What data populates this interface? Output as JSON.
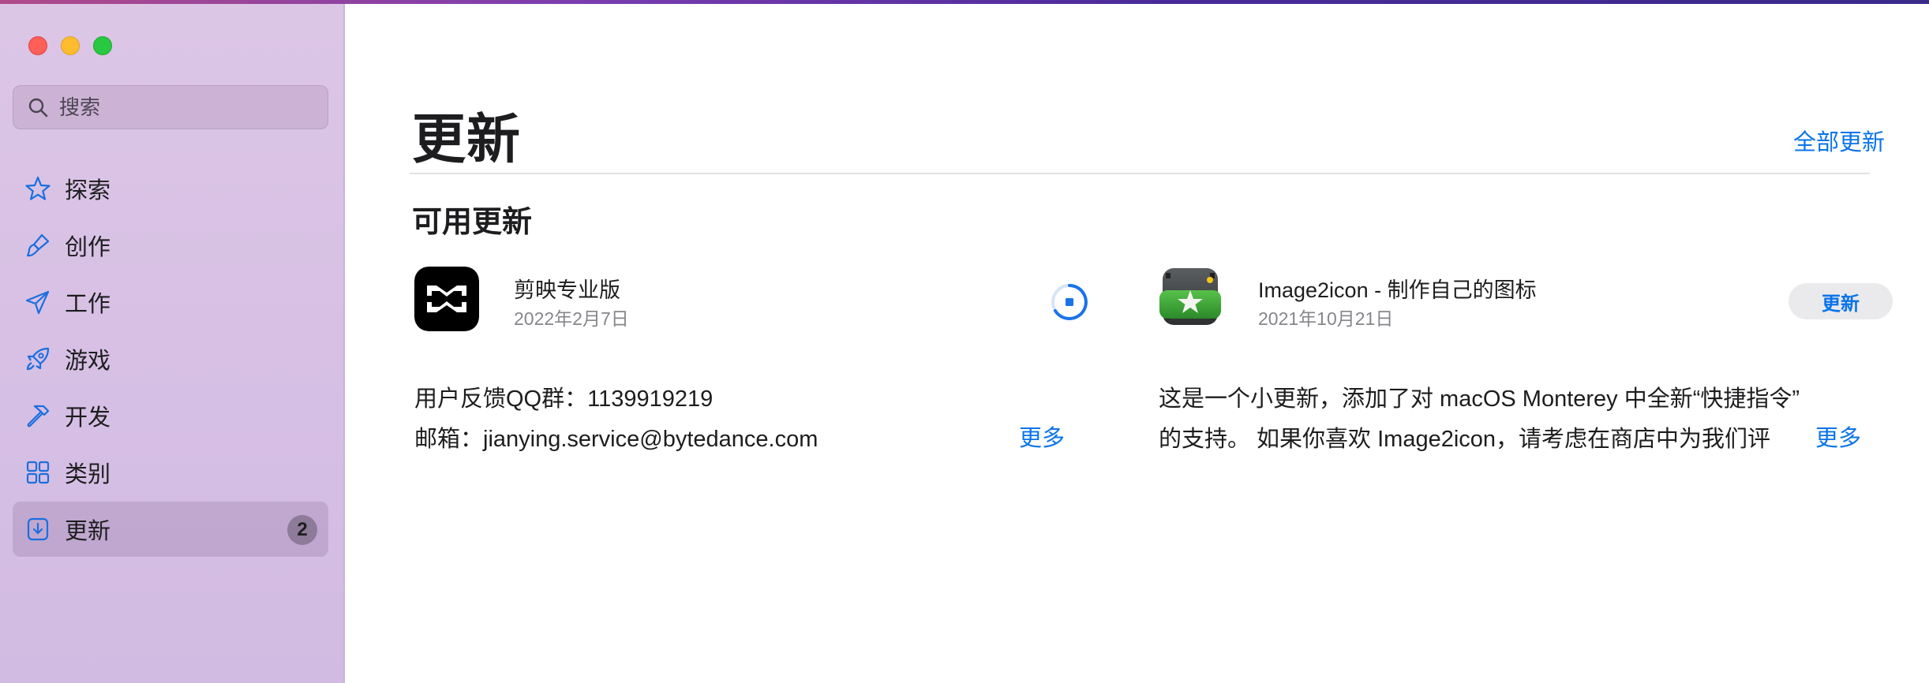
{
  "sidebar": {
    "search": {
      "placeholder": "搜索"
    },
    "items": [
      {
        "label": "探索",
        "icon": "star-icon",
        "active": false
      },
      {
        "label": "创作",
        "icon": "paintbrush-icon",
        "active": false
      },
      {
        "label": "工作",
        "icon": "paperplane-icon",
        "active": false
      },
      {
        "label": "游戏",
        "icon": "rocket-icon",
        "active": false
      },
      {
        "label": "开发",
        "icon": "hammer-icon",
        "active": false
      },
      {
        "label": "类别",
        "icon": "grid-icon",
        "active": false
      },
      {
        "label": "更新",
        "icon": "download-icon",
        "active": true,
        "badge": "2"
      }
    ]
  },
  "main": {
    "title": "更新",
    "update_all": "全部更新",
    "section_title": "可用更新",
    "apps": [
      {
        "name": "剪映专业版",
        "date": "2022年2月7日",
        "status": "downloading",
        "notes_line1": "用户反馈QQ群：1139919219",
        "notes_line2": "邮箱：jianying.service@bytedance.com",
        "more": "更多"
      },
      {
        "name": "Image2icon - 制作自己的图标",
        "date": "2021年10月21日",
        "button": "更新",
        "notes_line1": "这是一个小更新，添加了对 macOS Monterey 中全新“快捷指令”",
        "notes_line2": "的支持。 如果你喜欢 Image2icon，请考虑在商店中为我们评",
        "more": "更多"
      }
    ]
  },
  "colors": {
    "accent": "#0a74e8",
    "sidebar_bg": "#d9c3e5",
    "capcut_icon": "#000000",
    "image2icon_green": "#3aa33a"
  }
}
